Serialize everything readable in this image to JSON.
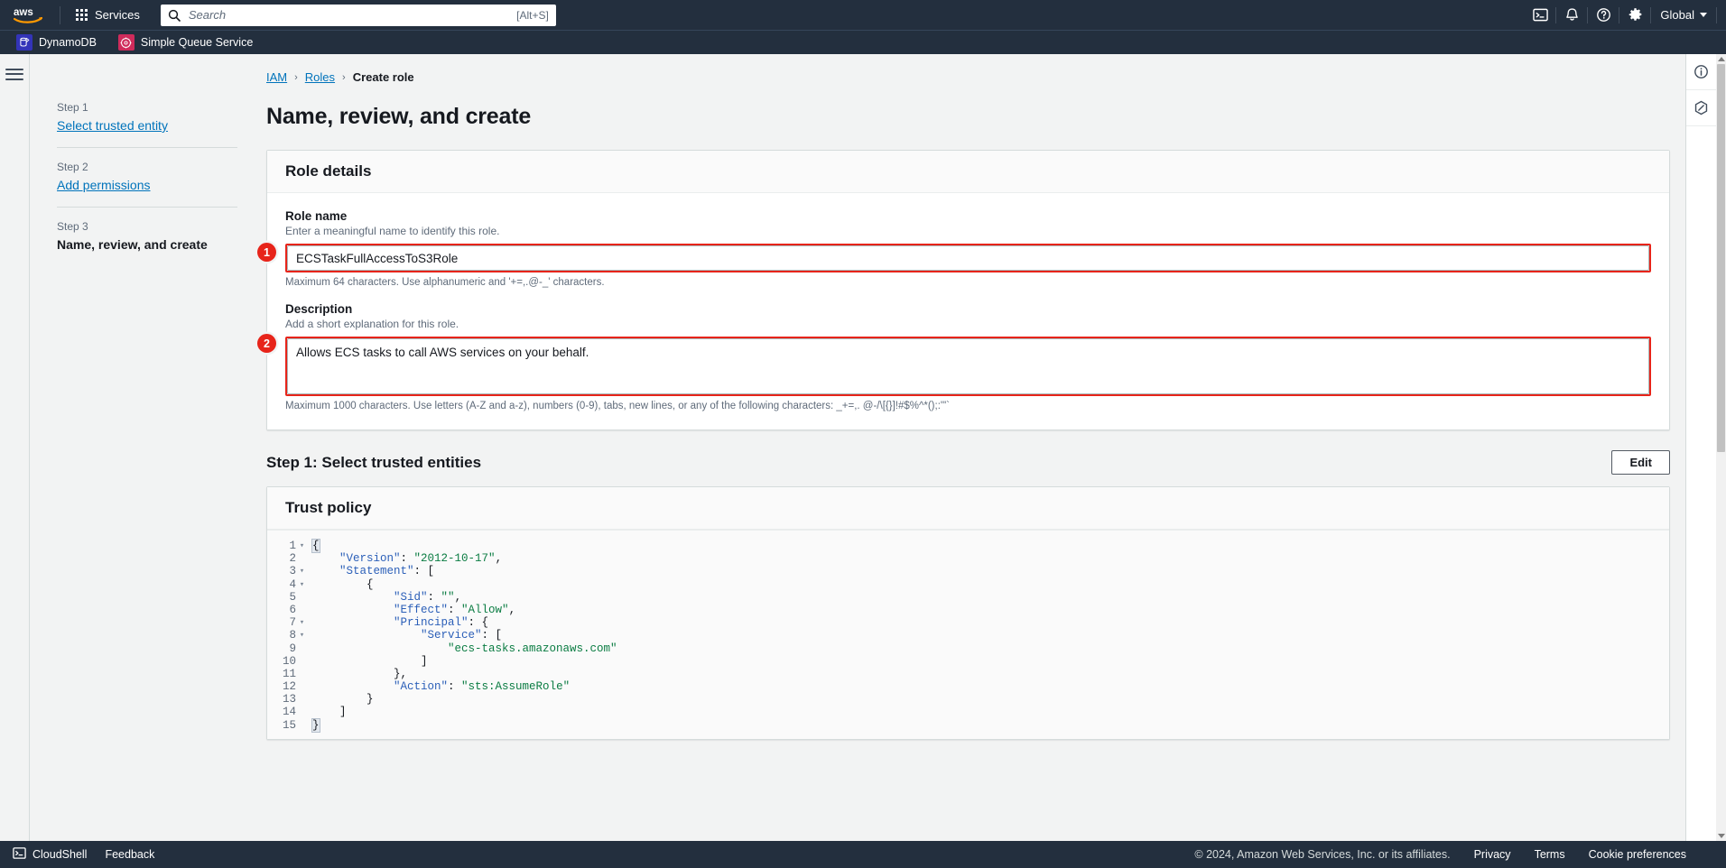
{
  "topnav": {
    "logo_alt": "aws",
    "services_label": "Services",
    "search": {
      "placeholder": "Search",
      "value": "",
      "shortcut": "[Alt+S]",
      "icon": "search-icon"
    },
    "icons": [
      {
        "name": "cloudshell-icon",
        "label": "CloudShell"
      },
      {
        "name": "notifications-bell-icon",
        "label": "Notifications"
      },
      {
        "name": "help-question-icon",
        "label": "Help"
      },
      {
        "name": "settings-gear-icon",
        "label": "Settings"
      }
    ],
    "region": {
      "label": "Global",
      "caret": "chevron-down-icon"
    }
  },
  "favorites_bar": {
    "items": [
      {
        "label": "DynamoDB",
        "icon": "dynamodb-icon",
        "color": "#3334b9"
      },
      {
        "label": "Simple Queue Service",
        "icon": "sqs-icon",
        "color": "#cf2b5b"
      }
    ]
  },
  "breadcrumb": {
    "items": [
      {
        "label": "IAM",
        "link": true
      },
      {
        "label": "Roles",
        "link": true
      },
      {
        "label": "Create role",
        "link": false
      }
    ],
    "separator": "›"
  },
  "stepnav": {
    "steps": [
      {
        "number": "Step 1",
        "label": "Select trusted entity",
        "current": false
      },
      {
        "number": "Step 2",
        "label": "Add permissions",
        "current": false
      },
      {
        "number": "Step 3",
        "label": "Name, review, and create",
        "current": true
      }
    ]
  },
  "page": {
    "title": "Name, review, and create"
  },
  "role_details": {
    "card_title": "Role details",
    "role_name": {
      "label": "Role name",
      "description": "Enter a meaningful name to identify this role.",
      "value": "ECSTaskFullAccessToS3Role",
      "placeholder": "",
      "hint": "Maximum 64 characters. Use alphanumeric and '+=,.@-_' characters.",
      "callout": "1"
    },
    "description": {
      "label": "Description",
      "description": "Add a short explanation for this role.",
      "value": "Allows ECS tasks to call AWS services on your behalf.",
      "placeholder": "",
      "hint": "Maximum 1000 characters. Use letters (A-Z and a-z), numbers (0-9), tabs, new lines, or any of the following characters: _+=,. @-/\\[{}]!#$%^*();:'\"`",
      "callout": "2"
    }
  },
  "step1_section": {
    "heading": "Step 1: Select trusted entities",
    "edit_button": "Edit",
    "trust_policy": {
      "card_title": "Trust policy",
      "lines": [
        {
          "n": "1",
          "foldable": true,
          "tokens": [
            {
              "t": "{",
              "c": "punc-hl"
            }
          ]
        },
        {
          "n": "2",
          "foldable": false,
          "tokens": [
            {
              "t": "    ",
              "c": "punc"
            },
            {
              "t": "\"Version\"",
              "c": "key"
            },
            {
              "t": ": ",
              "c": "punc"
            },
            {
              "t": "\"2012-10-17\"",
              "c": "str"
            },
            {
              "t": ",",
              "c": "punc"
            }
          ]
        },
        {
          "n": "3",
          "foldable": true,
          "tokens": [
            {
              "t": "    ",
              "c": "punc"
            },
            {
              "t": "\"Statement\"",
              "c": "key"
            },
            {
              "t": ": [",
              "c": "punc"
            }
          ]
        },
        {
          "n": "4",
          "foldable": true,
          "tokens": [
            {
              "t": "        {",
              "c": "punc"
            }
          ]
        },
        {
          "n": "5",
          "foldable": false,
          "tokens": [
            {
              "t": "            ",
              "c": "punc"
            },
            {
              "t": "\"Sid\"",
              "c": "key"
            },
            {
              "t": ": ",
              "c": "punc"
            },
            {
              "t": "\"\"",
              "c": "str"
            },
            {
              "t": ",",
              "c": "punc"
            }
          ]
        },
        {
          "n": "6",
          "foldable": false,
          "tokens": [
            {
              "t": "            ",
              "c": "punc"
            },
            {
              "t": "\"Effect\"",
              "c": "key"
            },
            {
              "t": ": ",
              "c": "punc"
            },
            {
              "t": "\"Allow\"",
              "c": "str"
            },
            {
              "t": ",",
              "c": "punc"
            }
          ]
        },
        {
          "n": "7",
          "foldable": true,
          "tokens": [
            {
              "t": "            ",
              "c": "punc"
            },
            {
              "t": "\"Principal\"",
              "c": "key"
            },
            {
              "t": ": {",
              "c": "punc"
            }
          ]
        },
        {
          "n": "8",
          "foldable": true,
          "tokens": [
            {
              "t": "                ",
              "c": "punc"
            },
            {
              "t": "\"Service\"",
              "c": "key"
            },
            {
              "t": ": [",
              "c": "punc"
            }
          ]
        },
        {
          "n": "9",
          "foldable": false,
          "tokens": [
            {
              "t": "                    ",
              "c": "punc"
            },
            {
              "t": "\"ecs-tasks.amazonaws.com\"",
              "c": "str"
            }
          ]
        },
        {
          "n": "10",
          "foldable": false,
          "tokens": [
            {
              "t": "                ]",
              "c": "punc"
            }
          ]
        },
        {
          "n": "11",
          "foldable": false,
          "tokens": [
            {
              "t": "            },",
              "c": "punc"
            }
          ]
        },
        {
          "n": "12",
          "foldable": false,
          "tokens": [
            {
              "t": "            ",
              "c": "punc"
            },
            {
              "t": "\"Action\"",
              "c": "key"
            },
            {
              "t": ": ",
              "c": "punc"
            },
            {
              "t": "\"sts:AssumeRole\"",
              "c": "str"
            }
          ]
        },
        {
          "n": "13",
          "foldable": false,
          "tokens": [
            {
              "t": "        }",
              "c": "punc"
            }
          ]
        },
        {
          "n": "14",
          "foldable": false,
          "tokens": [
            {
              "t": "    ]",
              "c": "punc"
            }
          ]
        },
        {
          "n": "15",
          "foldable": false,
          "tokens": [
            {
              "t": "}",
              "c": "punc-hl"
            }
          ]
        }
      ]
    }
  },
  "help_rail": {
    "buttons": [
      {
        "name": "info-panel-icon",
        "label": "Info"
      },
      {
        "name": "shortcuts-panel-icon",
        "label": "Shortcuts"
      }
    ]
  },
  "footer": {
    "cloudshell_label": "CloudShell",
    "feedback_label": "Feedback",
    "copyright": "© 2024, Amazon Web Services, Inc. or its affiliates.",
    "links": [
      {
        "label": "Privacy"
      },
      {
        "label": "Terms"
      },
      {
        "label": "Cookie preferences"
      }
    ]
  },
  "colors": {
    "nav_bg": "#232f3e",
    "page_bg": "#f2f3f3",
    "link": "#0073bb",
    "highlight_red": "#e7241a",
    "json_key": "#2b5fb8",
    "json_string": "#0a7c42"
  }
}
